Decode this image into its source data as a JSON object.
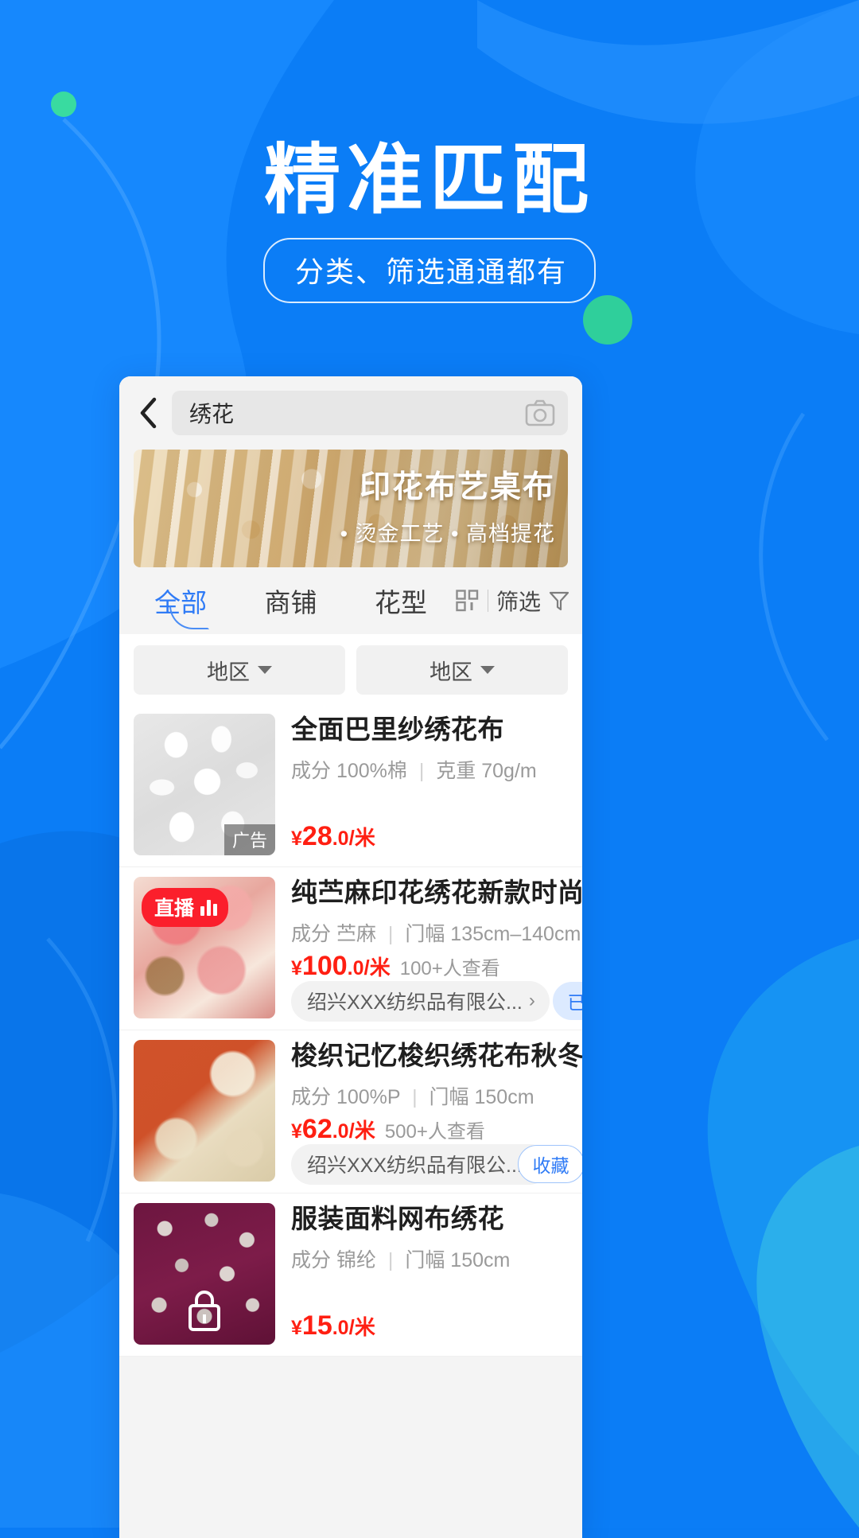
{
  "promo": {
    "title": "精准匹配",
    "subtitle": "分类、筛选通通都有",
    "bg_color": "#0a7cf5",
    "accent_green": "#2fcf9b"
  },
  "app": {
    "search": {
      "back_icon": "chevron-left-icon",
      "keyword": "绣花",
      "placeholder": "绣花",
      "camera_icon": "camera-icon"
    },
    "banner": {
      "title": "印花布艺桌布",
      "features": "• 烫金工艺  • 高档提花"
    },
    "tabs": [
      {
        "label": "全部",
        "active": true
      },
      {
        "label": "商铺",
        "active": false
      },
      {
        "label": "花型",
        "active": false
      }
    ],
    "filter": {
      "grid_icon": "grid-view-icon",
      "label": "筛选",
      "funnel_icon": "funnel-filter-icon"
    },
    "region_filters": [
      {
        "label": "地区",
        "caret": "chevron-down-icon"
      },
      {
        "label": "地区",
        "caret": "chevron-down-icon"
      }
    ],
    "products": [
      {
        "title": "全面巴里纱绣花布",
        "spec_left": "成分 100%棉",
        "spec_right": "克重 70g/m",
        "price_yen": "¥",
        "price_int": "28",
        "price_dec": ".0",
        "price_unit": "/米",
        "views": "",
        "shop": "",
        "fav_label": "",
        "fav_state": "none",
        "ad_badge": "广告",
        "live_badge": "",
        "locked": false,
        "thumb_class": "tx1"
      },
      {
        "title": "纯苎麻印花绣花新款时尚女装",
        "spec_left": "成分 苎麻",
        "spec_right": "门幅 135cm–140cm",
        "price_yen": "¥",
        "price_int": "100",
        "price_dec": ".0",
        "price_unit": "/米",
        "views": "100+人查看",
        "shop": "绍兴XXX纺织品有限公...",
        "fav_label": "已收藏",
        "fav_state": "saved",
        "ad_badge": "",
        "live_badge": "直播",
        "locked": false,
        "thumb_class": "tx2"
      },
      {
        "title": "梭织记忆梭织绣花布秋冬",
        "spec_left": "成分 100%P",
        "spec_right": "门幅 150cm",
        "price_yen": "¥",
        "price_int": "62",
        "price_dec": ".0",
        "price_unit": "/米",
        "views": "500+人查看",
        "shop": "绍兴XXX纺织品有限公...",
        "fav_label": "收藏",
        "fav_state": "unsaved",
        "ad_badge": "",
        "live_badge": "",
        "locked": false,
        "thumb_class": "tx3"
      },
      {
        "title": "服装面料网布绣花",
        "spec_left": "成分 锦纶",
        "spec_right": "门幅 150cm",
        "price_yen": "¥",
        "price_int": "15",
        "price_dec": ".0",
        "price_unit": "/米",
        "views": "",
        "shop": "",
        "fav_label": "",
        "fav_state": "none",
        "ad_badge": "",
        "live_badge": "",
        "locked": true,
        "thumb_class": "tx4"
      }
    ]
  }
}
